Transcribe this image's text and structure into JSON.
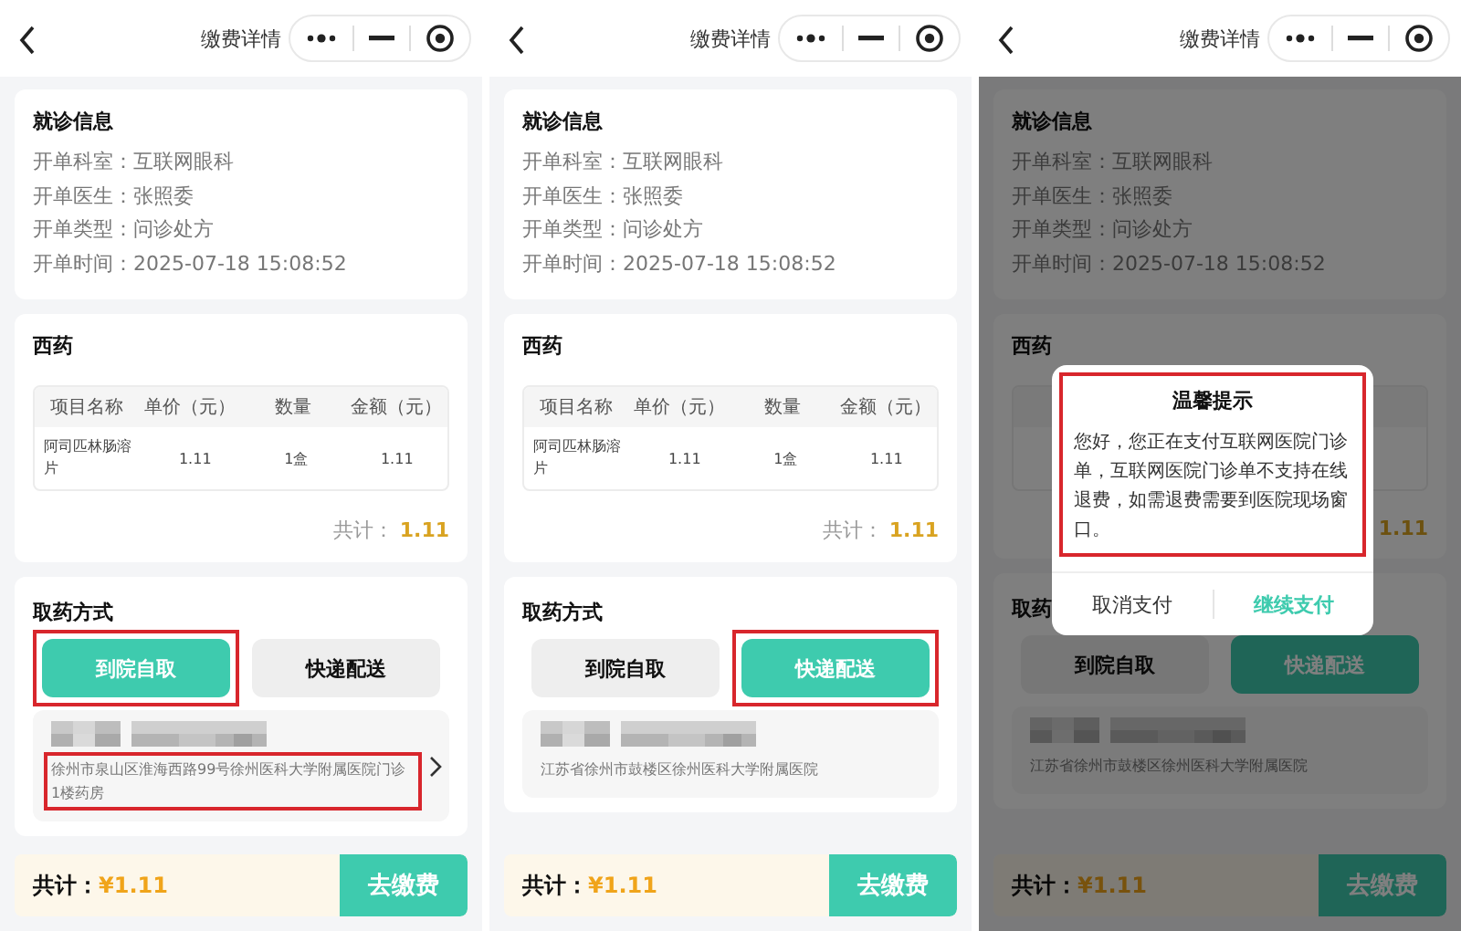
{
  "screens": [
    {
      "nav": {
        "title": "缴费详情"
      },
      "visit_info": {
        "title": "就诊信息",
        "rows": [
          {
            "label": "开单科室：",
            "value": "互联网眼科"
          },
          {
            "label": "开单医生：",
            "value": "张照委"
          },
          {
            "label": "开单类型：",
            "value": "问诊处方"
          },
          {
            "label": "开单时间：",
            "value": "2025-07-18 15:08:52"
          }
        ]
      },
      "medicine": {
        "title": "西药",
        "columns": [
          "项目名称",
          "单价（元）",
          "数量",
          "金额（元）"
        ],
        "rows": [
          [
            "阿司匹林肠溶片",
            "1.11",
            "1盒",
            "1.11"
          ]
        ],
        "total_label": "共计：",
        "total_value": "1.11"
      },
      "pickup": {
        "title": "取药方式",
        "options": [
          {
            "label": "到院自取",
            "selected": true,
            "highlighted": true
          },
          {
            "label": "快递配送",
            "selected": false,
            "highlighted": false
          }
        ],
        "address": {
          "text": "徐州市泉山区淮海西路99号徐州医科大学附属医院门诊1楼药房",
          "chevron": true,
          "highlighted": true
        }
      },
      "footer": {
        "total_label": "共计：",
        "amount": "¥1.11",
        "pay_button": "去缴费"
      }
    },
    {
      "nav": {
        "title": "缴费详情"
      },
      "visit_info": {
        "title": "就诊信息",
        "rows": [
          {
            "label": "开单科室：",
            "value": "互联网眼科"
          },
          {
            "label": "开单医生：",
            "value": "张照委"
          },
          {
            "label": "开单类型：",
            "value": "问诊处方"
          },
          {
            "label": "开单时间：",
            "value": "2025-07-18 15:08:52"
          }
        ]
      },
      "medicine": {
        "title": "西药",
        "columns": [
          "项目名称",
          "单价（元）",
          "数量",
          "金额（元）"
        ],
        "rows": [
          [
            "阿司匹林肠溶片",
            "1.11",
            "1盒",
            "1.11"
          ]
        ],
        "total_label": "共计：",
        "total_value": "1.11"
      },
      "pickup": {
        "title": "取药方式",
        "options": [
          {
            "label": "到院自取",
            "selected": false,
            "highlighted": false
          },
          {
            "label": "快递配送",
            "selected": true,
            "highlighted": true
          }
        ],
        "address": {
          "text": "江苏省徐州市鼓楼区徐州医科大学附属医院",
          "chevron": false,
          "highlighted": false
        }
      },
      "footer": {
        "total_label": "共计：",
        "amount": "¥1.11",
        "pay_button": "去缴费"
      }
    },
    {
      "nav": {
        "title": "缴费详情"
      },
      "visit_info": {
        "title": "就诊信息",
        "rows": [
          {
            "label": "开单科室：",
            "value": "互联网眼科"
          },
          {
            "label": "开单医生：",
            "value": "张照委"
          },
          {
            "label": "开单类型：",
            "value": "问诊处方"
          },
          {
            "label": "开单时间：",
            "value": "2025-07-18 15:08:52"
          }
        ]
      },
      "medicine": {
        "title": "西药",
        "total_value": "1.11"
      },
      "pickup": {
        "title": "取药",
        "options": [
          {
            "label": "到院自取",
            "selected": false,
            "highlighted": false
          },
          {
            "label": "快递配送",
            "selected": true,
            "highlighted": false
          }
        ],
        "address": {
          "text": "江苏省徐州市鼓楼区徐州医科大学附属医院",
          "chevron": false,
          "highlighted": false
        }
      },
      "footer": {
        "total_label": "共计：",
        "amount": "¥1.11",
        "pay_button": "去缴费"
      },
      "dialog": {
        "title": "温馨提示",
        "message": "您好，您正在支付互联网医院门诊单，互联网医院门诊单不支持在线退费，如需退费需要到医院现场窗口。",
        "highlighted": true,
        "buttons": [
          {
            "label": "取消支付",
            "kind": "cancel"
          },
          {
            "label": "继续支付",
            "kind": "confirm"
          }
        ]
      }
    }
  ]
}
